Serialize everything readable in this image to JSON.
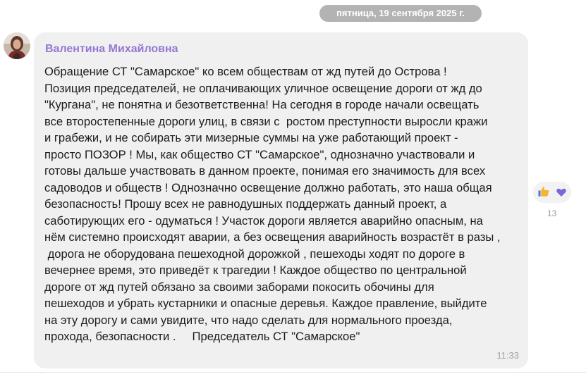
{
  "date_separator": "пятница, 19 сентября 2025 г.",
  "message": {
    "sender": "Валентина Михайловна",
    "lines": [
      "Обращение СТ \"Самарское\" ко всем обществам от жд путей до Острова !",
      "Позиция председателей, не оплачивающих уличное освещение дороги от жд до",
      "\"Кургана\", не понятна и безответственна! На сегодня в городе начали освещать",
      "все второстепенные дороги улиц, в связи с  ростом преступности выросли кражи",
      "и грабежи, и не собирать эти мизерные суммы на уже работающий проект -",
      "просто ПОЗОР ! Мы, как общество СТ \"Самарское\", однозначно участвовали и",
      "готовы дальше участвовать в данном проекте, понимая его значимость для всех",
      "садоводов и обществ ! Однозначно освещение должно работать, это наша общая",
      "безопасность! Прошу всех не равнодушных поддержать данный проект, а",
      "саботирующих его - одуматься ! Участок дороги является аварийно опасным, на",
      "нём системно происходят аварии, а без освещения аварийность возрастёт в разы ,",
      " дорога не оборудована пешеходной дорожкой , пешеходы ходят по дороге в",
      "вечернее время, это приведёт к трагедии ! Каждое общество по центральной",
      "дороге от жд путей обязано за своими заборами покосить обочины для",
      "пешеходов и убрать кустарники и опасные деревья. Каждое правление, выйдите",
      "на эту дорогу и сами увидите, что надо сделать для нормального проезда,",
      "прохода, безопасности .     Председатель СТ \"Самарское\""
    ],
    "time": "11:33"
  },
  "reactions": {
    "icons": [
      "thumbs-up",
      "heart"
    ],
    "count": "13"
  },
  "colors": {
    "sender_name": "#9477d3",
    "bubble_bg": "#f0f0f1",
    "date_pill_bg": "#b3b3b3",
    "heart": "#7b68d9"
  }
}
